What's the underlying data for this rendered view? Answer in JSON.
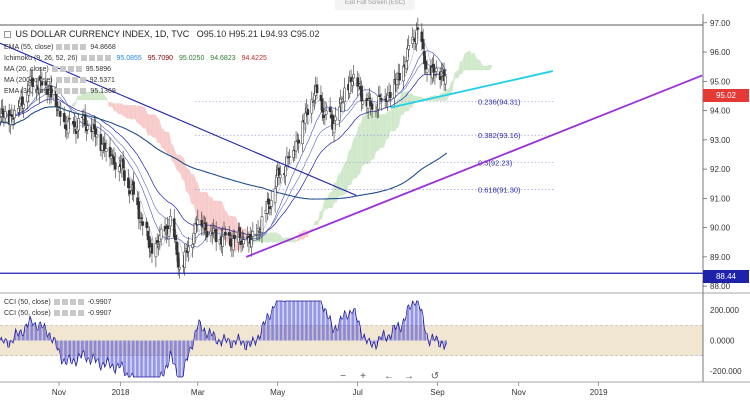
{
  "toolbar": {
    "exit_label": "Exit Full Screen (ESC)"
  },
  "header": {
    "symbol": "US DOLLAR CURRENCY INDEX, 1D, TVC",
    "open_label": "O",
    "open": "95.10",
    "high_label": "H",
    "high": "95.21",
    "low_label": "L",
    "low": "94.93",
    "close_label": "C",
    "close": "95.02"
  },
  "legends": [
    {
      "label": "EMA (55, close)",
      "values": [
        "94.8668"
      ]
    },
    {
      "label": "Ichimoku (9, 26, 52, 26)",
      "values": [
        "95.0855",
        "95.7090",
        "95.0250",
        "94.6823",
        "94.4225"
      ]
    },
    {
      "label": "MA (20, close)",
      "values": [
        "95.5896"
      ]
    },
    {
      "label": "MA (200, close)",
      "values": [
        "92.5371"
      ]
    },
    {
      "label": "EMA (34, close)",
      "values": [
        "95.1369"
      ]
    }
  ],
  "cci_legends": [
    {
      "label": "CCI (50, close)",
      "value": "-0.9907"
    },
    {
      "label": "CCI (50, close)",
      "value": "-0.9907"
    }
  ],
  "price_tags": [
    {
      "value": "95.02",
      "color": "#e53935"
    },
    {
      "value": "88.44",
      "color": "#1e22aa"
    }
  ],
  "nav": [
    "−",
    "+",
    "←",
    "→",
    "↺"
  ],
  "colors": {
    "up_candle": "#ffffff",
    "down_candle": "#333333",
    "cloud_bull": "#cfe8c8",
    "cloud_bear": "#f7c9c9",
    "trend_purple": "#9b30d9",
    "trend_cyan": "#22d0e8",
    "trend_blue": "#1e22aa",
    "ma200": "#1f4e8c",
    "cci_fill": "#2a2ad0",
    "cci_band": "#f0e6d2"
  },
  "chart_data": {
    "type": "candlestick",
    "title": "US DOLLAR CURRENCY INDEX, 1D, TVC",
    "ylim": [
      87.8,
      97.3
    ],
    "y_ticks": [
      "97.00",
      "96.00",
      "95.00",
      "94.00",
      "93.00",
      "92.00",
      "91.00",
      "90.00",
      "89.00",
      "88.00"
    ],
    "x_ticks": [
      "Nov",
      "2018",
      "Mar",
      "May",
      "Jul",
      "Sep",
      "Nov",
      "2019"
    ],
    "horizontal_line": 88.44,
    "fib_levels": [
      {
        "label": "0.236(94.31)",
        "value": 94.31
      },
      {
        "label": "0.382(93.16)",
        "value": 93.16
      },
      {
        "label": "0.5(92.23)",
        "value": 92.23
      },
      {
        "label": "0.618(91.30)",
        "value": 91.3
      }
    ],
    "trend_points": [
      [
        "Oct 10",
        93.8
      ],
      [
        "Oct 26",
        95.0
      ],
      [
        "Nov 07",
        94.8
      ],
      [
        "Nov 20",
        93.4
      ],
      [
        "Dec 05",
        93.6
      ],
      [
        "Dec 14",
        93.1
      ],
      [
        "Jan 02",
        92.0
      ],
      [
        "Jan 12",
        91.0
      ],
      [
        "Jan 25",
        89.1
      ],
      [
        "Feb 08",
        90.2
      ],
      [
        "Feb 16",
        88.5
      ],
      [
        "Mar 01",
        90.3
      ],
      [
        "Mar 14",
        89.7
      ],
      [
        "Mar 27",
        89.6
      ],
      [
        "Apr 11",
        89.5
      ],
      [
        "Apr 20",
        90.3
      ],
      [
        "May 01",
        91.7
      ],
      [
        "May 14",
        92.8
      ],
      [
        "May 29",
        94.6
      ],
      [
        "Jun 12",
        93.5
      ],
      [
        "Jun 27",
        95.2
      ],
      [
        "Jul 10",
        94.1
      ],
      [
        "Jul 25",
        94.6
      ],
      [
        "Aug 03",
        95.2
      ],
      [
        "Aug 15",
        96.8
      ],
      [
        "Aug 24",
        95.2
      ],
      [
        "Sep 04",
        95.3
      ],
      [
        "Sep 07",
        95.02
      ]
    ],
    "y_axis": {
      "label": "",
      "unit": ""
    },
    "cci": {
      "ylim": [
        -260,
        280
      ],
      "y_ticks": [
        "200.000",
        "0.0000",
        "-200.000"
      ],
      "band": [
        -100,
        100
      ],
      "last": -0.9907
    }
  }
}
